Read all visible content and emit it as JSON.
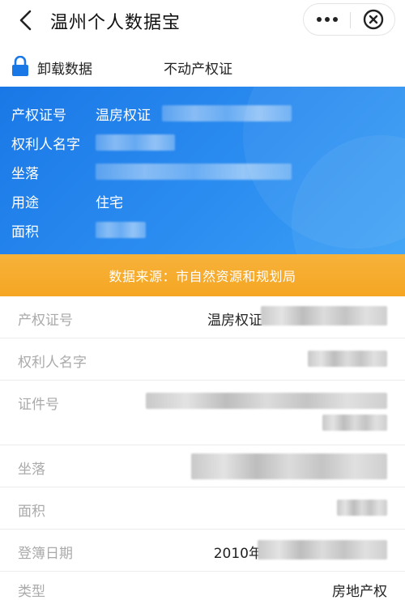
{
  "navbar": {
    "title": "温州个人数据宝",
    "back_icon": "chevron-left-icon",
    "more_icon": "more-dots-icon",
    "close_icon": "close-circle-icon"
  },
  "subheader": {
    "unload_label": "卸载数据",
    "document_type": "不动产权证",
    "lock_icon": "lock-icon"
  },
  "card": {
    "rows": [
      {
        "label": "产权证号",
        "value": "温房权证"
      },
      {
        "label": "权利人名字",
        "value": ""
      },
      {
        "label": "坐落",
        "value": ""
      },
      {
        "label": "用途",
        "value": "住宅"
      },
      {
        "label": "面积",
        "value": ""
      }
    ],
    "colors": {
      "start": "#1a78e6",
      "end": "#3aa0f5"
    }
  },
  "source": {
    "text": "数据来源：市自然资源和规划局",
    "color": "#f5a623"
  },
  "details": [
    {
      "label": "产权证号",
      "value": "温房权证"
    },
    {
      "label": "权利人名字",
      "value": ""
    },
    {
      "label": "证件号",
      "value": ""
    },
    {
      "label": "坐落",
      "value": ""
    },
    {
      "label": "面积",
      "value": ""
    },
    {
      "label": "登簿日期",
      "value": "2010年"
    },
    {
      "label": "类型",
      "value": "房地产权"
    }
  ]
}
